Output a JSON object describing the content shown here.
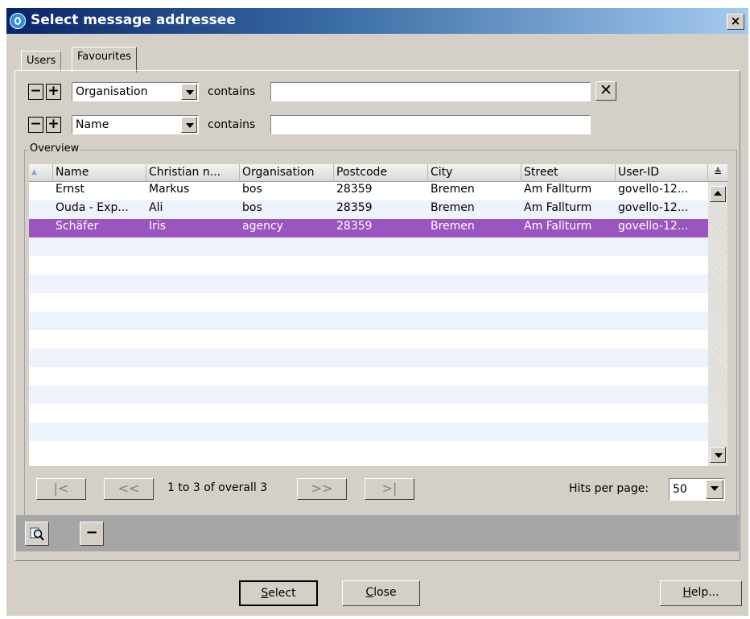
{
  "window": {
    "title": "Select message addressee",
    "close_glyph": "×"
  },
  "tabs": [
    "Users",
    "Favourites"
  ],
  "filters": [
    {
      "field": "Organisation",
      "operator": "contains",
      "value": ""
    },
    {
      "field": "Name",
      "operator": "contains",
      "value": ""
    }
  ],
  "filter_buttons": {
    "remove": "−",
    "add": "+",
    "clear": "✕"
  },
  "overview": {
    "label": "Overview",
    "columns": [
      "Name",
      "Christian n...",
      "Organisation",
      "Postcode",
      "City",
      "Street",
      "User-ID"
    ],
    "rows": [
      [
        "Ernst",
        "Markus",
        "bos",
        "28359",
        "Bremen",
        "Am Fallturm",
        "govello-12..."
      ],
      [
        "Ouda - Exp...",
        "Ali",
        "bos",
        "28359",
        "Bremen",
        "Am Fallturm",
        "govello-12..."
      ],
      [
        "Schäfer",
        "Iris",
        "agency",
        "28359",
        "Bremen",
        "Am Fallturm",
        "govello-12..."
      ]
    ],
    "selected_row": 2,
    "sort_indicator": "▲",
    "corner_glyph": "≜"
  },
  "pagination": {
    "first": "|<",
    "prev": "<<",
    "status": "1 to 3 of overall 3",
    "next": ">>",
    "last": ">|",
    "hits_label": "Hits per page:",
    "hits_value": "50"
  },
  "toolbar": {
    "search_icon": "magnifier-icon",
    "remove": "−"
  },
  "buttons": {
    "select": {
      "mnemonic": "S",
      "rest": "elect"
    },
    "close": {
      "mnemonic": "C",
      "rest": "lose"
    },
    "help": {
      "mnemonic": "H",
      "rest": "elp..."
    }
  },
  "colors": {
    "selection": "#9a55c0",
    "title_gradient_start": "#0a246a",
    "alt_row": "#eef2fa",
    "dialog_bg": "#d4d0c8"
  }
}
